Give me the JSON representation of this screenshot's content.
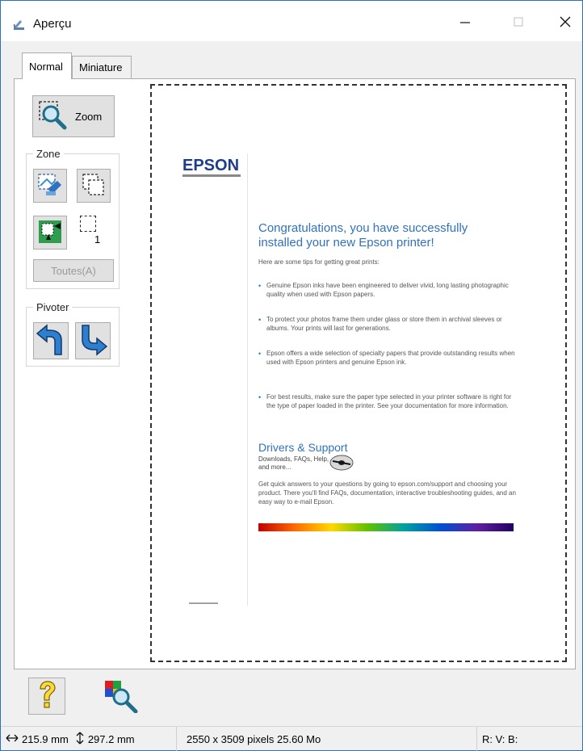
{
  "window": {
    "title": "Aperçu"
  },
  "tabs": [
    {
      "label": "Normal",
      "selected": true
    },
    {
      "label": "Miniature",
      "selected": false
    }
  ],
  "tools": {
    "zoom_label": "Zoom",
    "zone_group_label": "Zone",
    "marquee_count": "1",
    "all_button_label": "Toutes(A)",
    "rotate_group_label": "Pivoter"
  },
  "preview": {
    "brand": "EPSON",
    "headline": "Congratulations, you have successfully installed your new Epson printer!",
    "intro": "Here are some tips for getting great prints:",
    "tips": [
      "Genuine Epson inks have been engineered to deliver vivid, long lasting photographic quality when used with Epson papers.",
      "To protect your photos frame them under glass or store them in archival sleeves or albums. Your prints will last for generations.",
      "Epson offers a wide selection of specialty papers that provide outstanding results when used with Epson printers and genuine Epson ink.",
      "For best results, make sure the paper type selected in your printer software is right for the type of paper loaded in the printer. See your documentation for more information."
    ],
    "support_heading": "Drivers & Support",
    "support_sub": "Downloads, FAQs, Help, and more...",
    "support_body": "Get quick answers to your questions by going to epson.com/support and choosing your product. There you'll find FAQs, documentation, interactive troubleshooting guides, and an easy way to e-mail Epson."
  },
  "status": {
    "width": "215.9 mm",
    "height": "297.2 mm",
    "pixels": "2550 x 3509 pixels 25.60 Mo",
    "rgb": "R: V: B:"
  },
  "colors": {
    "accent": "#2f72c0",
    "brand": "#1c3c8c",
    "window_border": "#2b6fc9"
  },
  "icons": {
    "app": "scanner-icon",
    "zoom": "magnifier-icon",
    "zone_auto": "auto-locate-icon",
    "zone_multi": "multi-marquee-icon",
    "zone_marquee": "marquee-select-icon",
    "rotate_left": "rotate-left-icon",
    "rotate_right": "rotate-right-icon",
    "help": "help-icon",
    "color": "color-palette-icon"
  }
}
